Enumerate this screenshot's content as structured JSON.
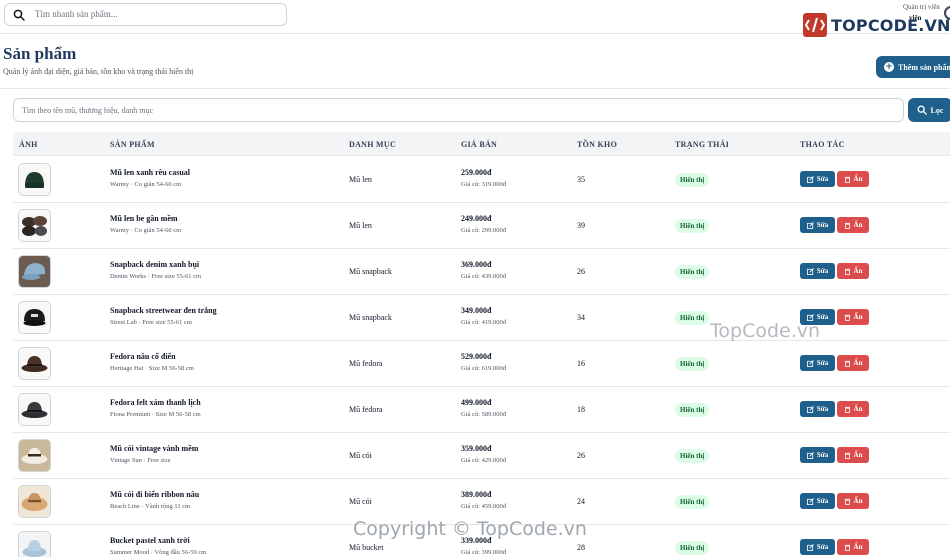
{
  "topbar": {
    "search_placeholder": "Tìm nhanh sản phẩm...",
    "user_role": "Quản trị viên",
    "user_name": "viên"
  },
  "watermark": {
    "logo_text": "TOPCODE.VN",
    "center_text": "TopCode.vn",
    "copyright_text": "Copyright © TopCode.vn"
  },
  "header": {
    "title": "Sản phẩm",
    "subtitle": "Quản lý ảnh đại diện, giá bán, tồn kho và trạng thái hiển thị",
    "add_button": "Thêm sản phẩm"
  },
  "filter": {
    "placeholder": "Tìm theo tên mũ, thương hiệu, danh mục",
    "button": "Lọc"
  },
  "table": {
    "columns": [
      "ẢNH",
      "SẢN PHẨM",
      "DANH MỤC",
      "GIÁ BÁN",
      "TỒN KHO",
      "TRẠNG THÁI",
      "THAO TÁC"
    ],
    "edit_label": "Sửa",
    "hide_label": "Ẩn",
    "rows": [
      {
        "image": "beanie-green",
        "name": "Mũ len xanh rêu casual",
        "meta": "Warmy · Co giãn 54-60 cm",
        "category": "Mũ len",
        "price": "259.000đ",
        "old_price": "Giá cũ: 319.000đ",
        "stock": "35",
        "status": "Hiển thị"
      },
      {
        "image": "beanie-beige",
        "name": "Mũ len be gân mềm",
        "meta": "Warmy · Co giãn 54-60 cm",
        "category": "Mũ len",
        "price": "249.000đ",
        "old_price": "Giá cũ: 299.000đ",
        "stock": "39",
        "status": "Hiển thị"
      },
      {
        "image": "snapback-denim",
        "name": "Snapback denim xanh bụi",
        "meta": "Denim Works · Free size 55-61 cm",
        "category": "Mũ snapback",
        "price": "369.000đ",
        "old_price": "Giá cũ: 439.000đ",
        "stock": "26",
        "status": "Hiển thị"
      },
      {
        "image": "snapback-black",
        "name": "Snapback streetwear đen trắng",
        "meta": "Street Lab · Free size 55-61 cm",
        "category": "Mũ snapback",
        "price": "349.000đ",
        "old_price": "Giá cũ: 419.000đ",
        "stock": "34",
        "status": "Hiển thị"
      },
      {
        "image": "fedora-brown",
        "name": "Fedora nâu cổ điển",
        "meta": "Heritage Hat · Size M 56-58 cm",
        "category": "Mũ fedora",
        "price": "529.000đ",
        "old_price": "Giá cũ: 619.000đ",
        "stock": "16",
        "status": "Hiển thị"
      },
      {
        "image": "fedora-gray",
        "name": "Fedora felt xám thanh lịch",
        "meta": "Fiona Premium · Size M 56-58 cm",
        "category": "Mũ fedora",
        "price": "499.000đ",
        "old_price": "Giá cũ: 589.000đ",
        "stock": "18",
        "status": "Hiển thị"
      },
      {
        "image": "straw-vintage",
        "name": "Mũ cói vintage vành mềm",
        "meta": "Vintage Sun · Free size",
        "category": "Mũ cói",
        "price": "359.000đ",
        "old_price": "Giá cũ: 429.000đ",
        "stock": "26",
        "status": "Hiển thị"
      },
      {
        "image": "straw-ribbon",
        "name": "Mũ cói đi biển ribbon nâu",
        "meta": "Beach Line · Vành rộng 11 cm",
        "category": "Mũ cói",
        "price": "389.000đ",
        "old_price": "Giá cũ: 459.000đ",
        "stock": "24",
        "status": "Hiển thị"
      },
      {
        "image": "bucket-pastel",
        "name": "Bucket pastel xanh trời",
        "meta": "Summer Mood · Vòng đầu 56-59 cm",
        "category": "Mũ bucket",
        "price": "339.000đ",
        "old_price": "Giá cũ: 399.000đ",
        "stock": "28",
        "status": "Hiển thị"
      }
    ]
  },
  "colors": {
    "primary": "#1f5f8b",
    "danger": "#dc4c4c",
    "success_bg": "#dcfce7",
    "success_text": "#166534",
    "title": "#1e3a5f"
  }
}
